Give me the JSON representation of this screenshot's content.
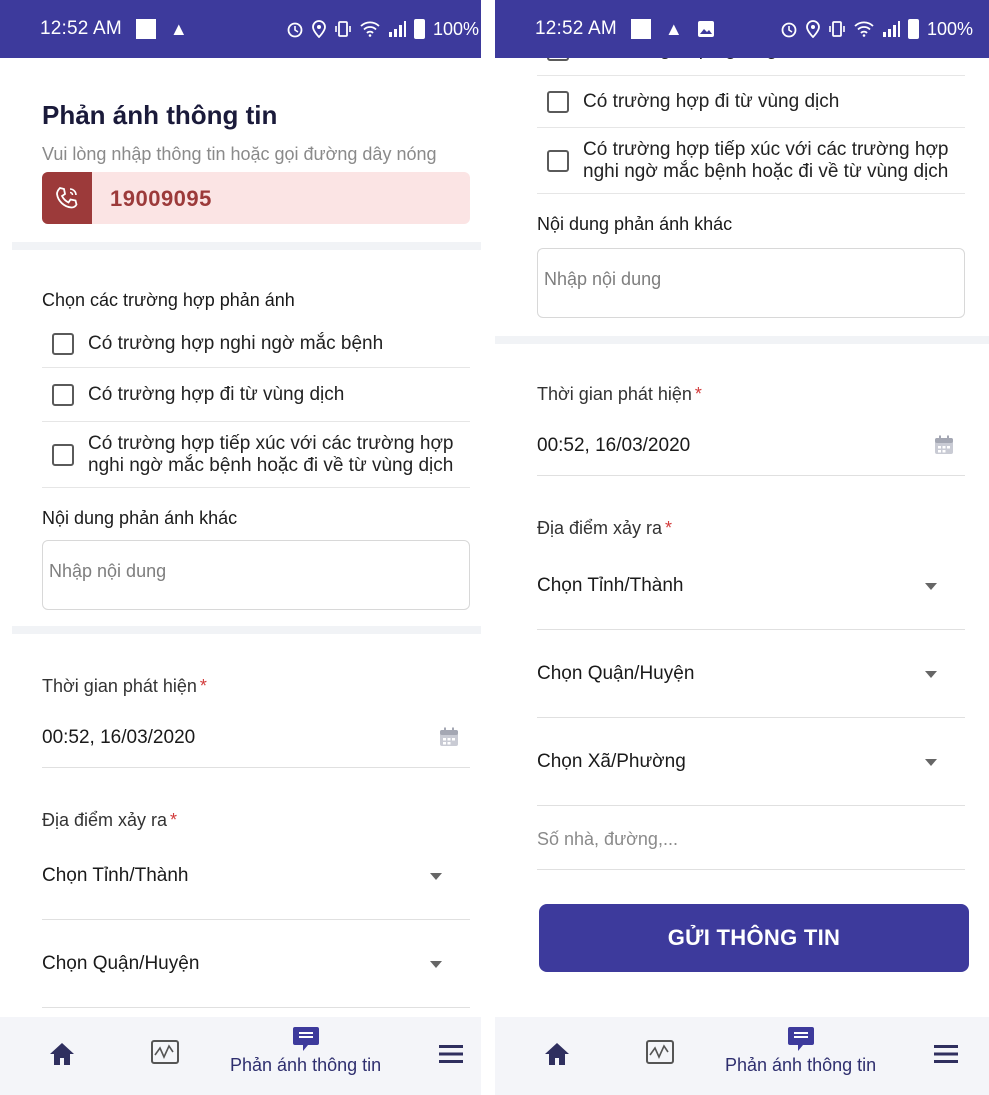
{
  "status_bar": {
    "time": "12:52 AM",
    "battery": "100%",
    "warn_glyph": "▲"
  },
  "form": {
    "title": "Phản ánh thông tin",
    "subtitle": "Vui lòng nhập thông tin hoặc gọi đường dây nóng",
    "hotline": "19009095",
    "cases_label": "Chọn các trường hợp phản ánh",
    "cases": [
      "Có trường hợp nghi ngờ mắc bệnh",
      "Có trường hợp đi từ vùng dịch",
      "Có trường hợp tiếp xúc với các trường hợp nghi ngờ mắc bệnh hoặc đi về từ vùng dịch"
    ],
    "other_label": "Nội dung phản ánh khác",
    "other_placeholder": "Nhập nội dung",
    "time_label": "Thời gian phát hiện",
    "required_mark": "*",
    "time_value": "00:52, 16/03/2020",
    "location_label": "Địa điểm xảy ra",
    "province": "Chọn Tỉnh/Thành",
    "district": "Chọn Quận/Huyện",
    "ward": "Chọn Xã/Phường",
    "address_placeholder": "Số nhà, đường,...",
    "submit": "GỬI THÔNG TIN"
  },
  "nav": {
    "active_label": "Phản ánh thông tin"
  },
  "colors": {
    "primary": "#3d3a9c",
    "hotline_bg": "#fbe4e4",
    "hotline_accent": "#9c3a3a",
    "required": "#d23b3b"
  }
}
